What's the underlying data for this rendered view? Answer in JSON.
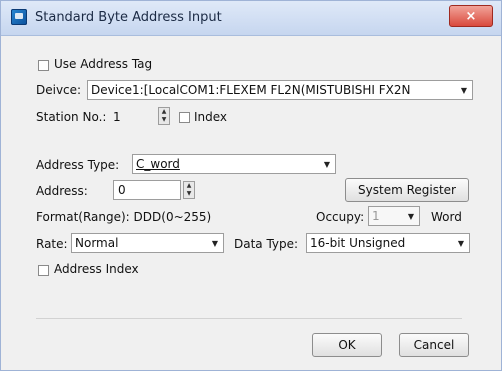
{
  "window": {
    "title": "Standard Byte Address Input",
    "close_label": "×"
  },
  "use_address_tag": {
    "label": "Use Address Tag"
  },
  "device": {
    "label": "Deivce:",
    "value": "Device1:[LocalCOM1:FLEXEM FL2N(MISTUBISHI FX2N"
  },
  "station": {
    "label": "Station No.:",
    "value": "1",
    "index_label": "Index"
  },
  "address_type": {
    "label": "Address Type:",
    "value": "C_word"
  },
  "address": {
    "label": "Address:",
    "value": "0"
  },
  "system_register_button": "System Register",
  "format": {
    "label": "Format(Range): DDD(0~255)"
  },
  "occupy": {
    "label": "Occupy:",
    "value": "1",
    "unit": "Word"
  },
  "rate": {
    "label": "Rate:",
    "value": "Normal"
  },
  "data_type": {
    "label": "Data Type:",
    "value": "16-bit Unsigned"
  },
  "address_index": {
    "label": "Address Index"
  },
  "buttons": {
    "ok": "OK",
    "cancel": "Cancel"
  },
  "icons": [
    "app-icon",
    "close-icon",
    "dropdown-arrow-icon",
    "spinner-icon"
  ],
  "colors": {
    "titlebar": "#c6d6ef",
    "close": "#d94a3d",
    "background": "#f0f0f0"
  }
}
